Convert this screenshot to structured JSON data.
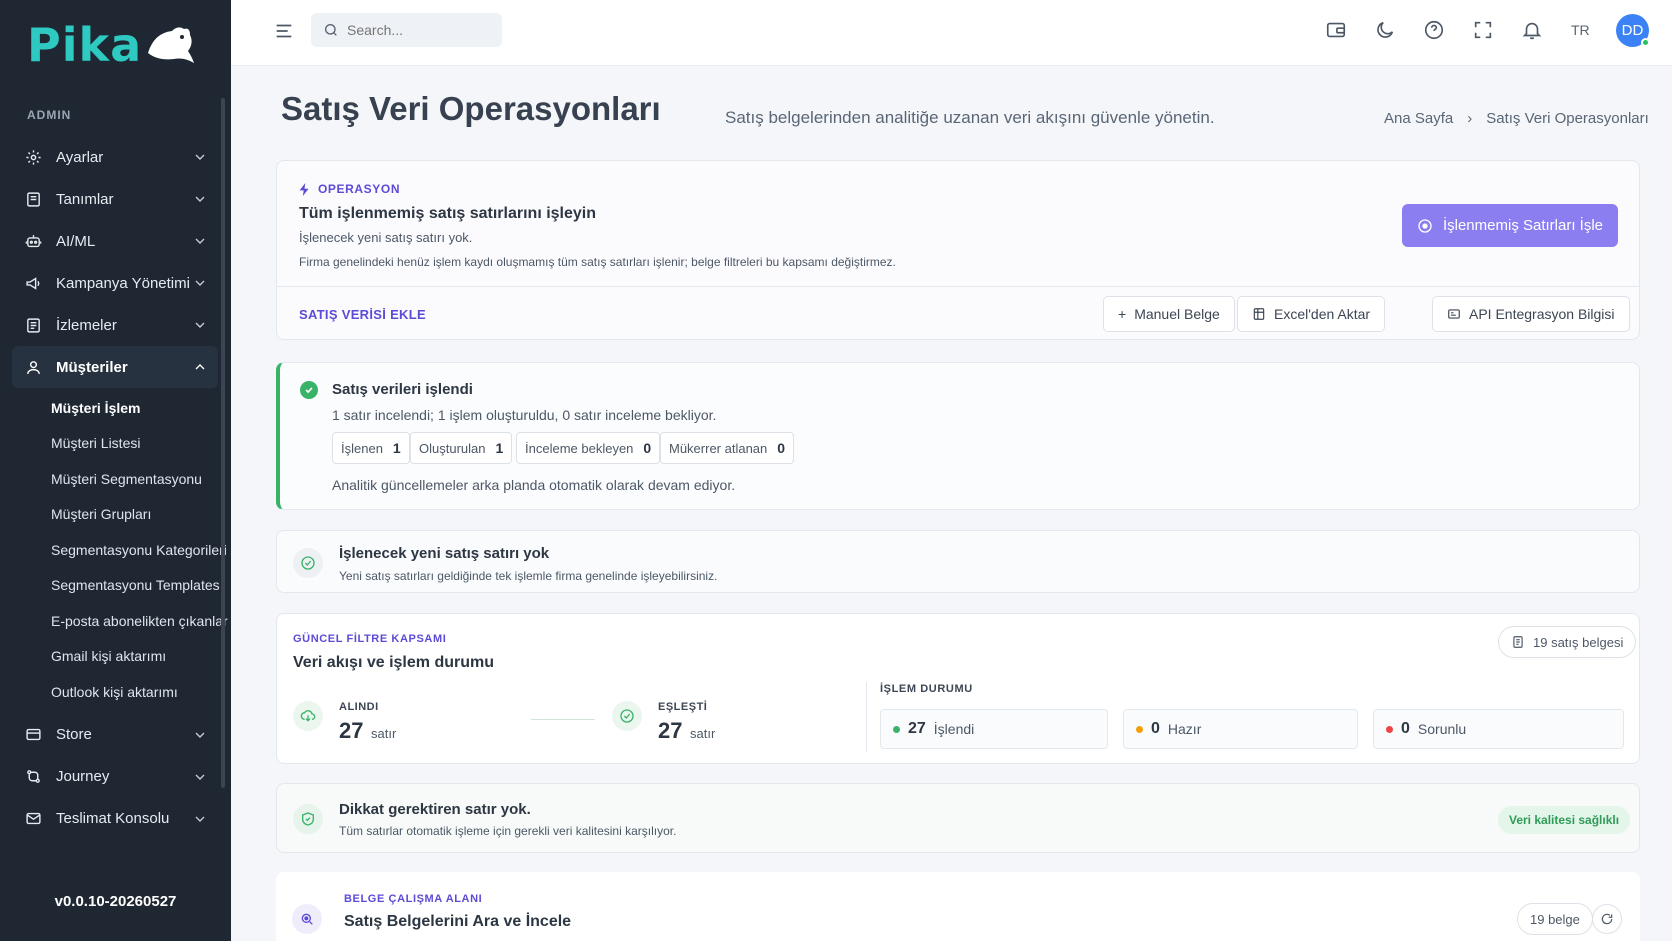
{
  "app": {
    "logo_text": "Pika",
    "version": "v0.0.10-20260527"
  },
  "sidebar": {
    "section_label": "ADMIN",
    "items": [
      {
        "label": "Ayarlar",
        "icon": "gear-icon"
      },
      {
        "label": "Tanımlar",
        "icon": "book-icon"
      },
      {
        "label": "AI/ML",
        "icon": "robot-icon"
      },
      {
        "label": "Kampanya Yönetimi",
        "icon": "megaphone-icon"
      },
      {
        "label": "İzlemeler",
        "icon": "list-icon"
      },
      {
        "label": "Müşteriler",
        "icon": "user-icon",
        "active": true
      },
      {
        "label": "Store",
        "icon": "store-icon"
      },
      {
        "label": "Journey",
        "icon": "route-icon"
      },
      {
        "label": "Teslimat Konsolu",
        "icon": "mail-icon"
      }
    ],
    "sub_items": [
      "Müşteri İşlem",
      "Müşteri Listesi",
      "Müşteri Segmentasyonu",
      "Müşteri Grupları",
      "Segmentasyonu Kategorileri",
      "Segmentasyonu Templates",
      "E-posta abonelikten çıkanlar",
      "Gmail kişi aktarımı",
      "Outlook kişi aktarımı"
    ]
  },
  "topbar": {
    "search_placeholder": "Search...",
    "lang": "TR",
    "avatar": "DD"
  },
  "page": {
    "title": "Satış Veri Operasyonları",
    "subtitle": "Satış belgelerinden analitiğe uzanan veri akışını güvenle yönetin.",
    "breadcrumb": [
      "Ana Sayfa",
      "Satış Veri Operasyonları"
    ]
  },
  "operation": {
    "tag": "OPERASYON",
    "title": "Tüm işlenmemiş satış satırlarını işleyin",
    "line1": "İşlenecek yeni satış satırı yok.",
    "line2": "Firma genelindeki henüz işlem kaydı oluşmamış tüm satış satırları işlenir; belge filtreleri bu kapsamı değiştirmez.",
    "primary_button": "İşlenmemiş Satırları İşle",
    "add_label": "SATIŞ VERİSİ EKLE",
    "buttons": [
      "Manuel Belge",
      "Excel'den Aktar",
      "API Entegrasyon Bilgisi"
    ]
  },
  "result": {
    "title": "Satış verileri işlendi",
    "summary": "1 satır incelendi; 1 işlem oluşturuldu, 0 satır inceleme bekliyor.",
    "chips": [
      {
        "label": "İşlenen",
        "value": "1"
      },
      {
        "label": "Oluşturulan",
        "value": "1"
      },
      {
        "label": "İnceleme bekleyen",
        "value": "0"
      },
      {
        "label": "Mükerrer atlanan",
        "value": "0"
      }
    ],
    "footer": "Analitik güncellemeler arka planda otomatik olarak devam ediyor."
  },
  "no_new": {
    "title": "İşlenecek yeni satış satırı yok",
    "sub": "Yeni satış satırları geldiğinde tek işlemle firma genelinde işleyebilirsiniz."
  },
  "flow": {
    "tag": "GÜNCEL FİLTRE KAPSAMI",
    "title": "Veri akışı ve işlem durumu",
    "doc_count": "19 satış belgesi",
    "received": {
      "label": "ALINDI",
      "value": "27",
      "unit": "satır"
    },
    "matched": {
      "label": "EŞLEŞTİ",
      "value": "27",
      "unit": "satır"
    },
    "status_label": "İŞLEM DURUMU",
    "statuses": [
      {
        "value": "27",
        "label": "İşlendi",
        "color": "#3ab36a"
      },
      {
        "value": "0",
        "label": "Hazır",
        "color": "#f59e0b"
      },
      {
        "value": "0",
        "label": "Sorunlu",
        "color": "#ef4444"
      }
    ]
  },
  "attention": {
    "title": "Dikkat gerektiren satır yok.",
    "sub": "Tüm satırlar otomatik işleme için gerekli veri kalitesini karşılıyor.",
    "badge": "Veri kalitesi sağlıklı"
  },
  "workspace": {
    "tag": "BELGE ÇALIŞMA ALANI",
    "title": "Satış Belgelerini Ara ve İncele",
    "count": "19 belge"
  },
  "colors": {
    "accent": "#8b7ef0",
    "sidebar": "#1e2732",
    "logo": "#2ec9c1",
    "success": "#3ab36a"
  }
}
